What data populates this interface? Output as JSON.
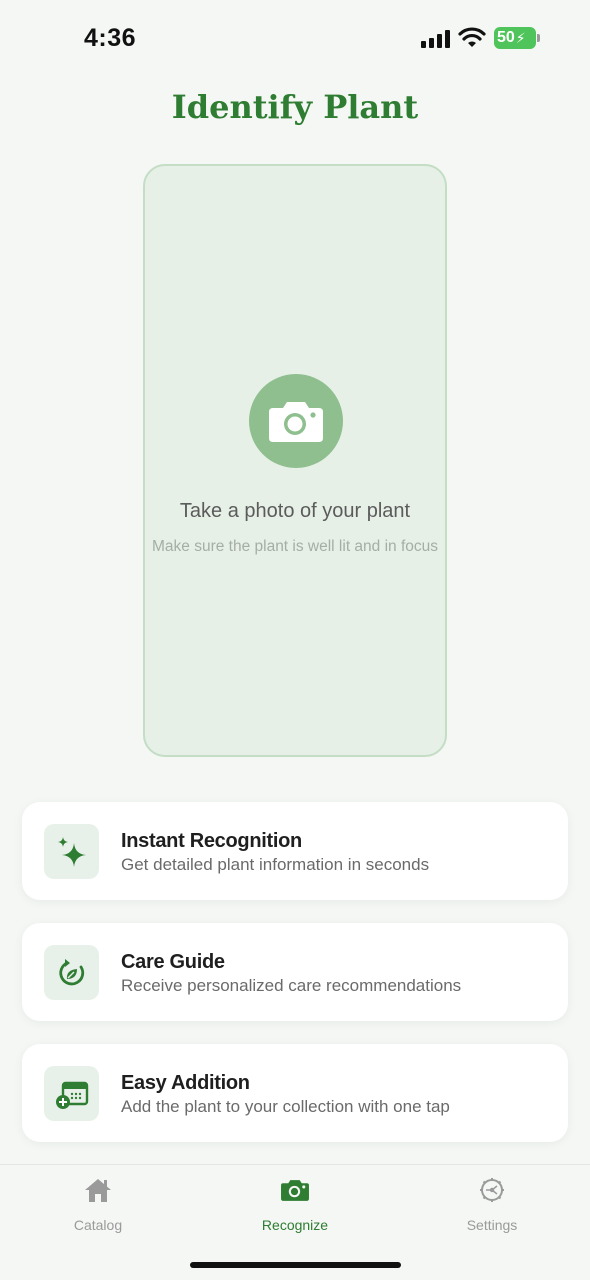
{
  "status_bar": {
    "time": "4:36",
    "battery": "50"
  },
  "header": {
    "title": "Identify Plant"
  },
  "camera": {
    "prompt": "Take a photo of your plant",
    "hint": "Make sure the plant is well lit and in focus"
  },
  "features": [
    {
      "title": "Instant Recognition",
      "description": "Get detailed plant information in seconds",
      "icon": "sparkles-icon"
    },
    {
      "title": "Care Guide",
      "description": "Receive personalized care recommendations",
      "icon": "care-cycle-icon"
    },
    {
      "title": "Easy Addition",
      "description": "Add the plant to your collection with one tap",
      "icon": "calendar-add-icon"
    }
  ],
  "tabs": [
    {
      "label": "Catalog",
      "icon": "home-icon",
      "active": false
    },
    {
      "label": "Recognize",
      "icon": "camera-icon",
      "active": true
    },
    {
      "label": "Settings",
      "icon": "gear-icon",
      "active": false
    }
  ],
  "colors": {
    "accent": "#2e7d32",
    "camera_area": "#e6f0e7",
    "camera_circle": "#8fbf8f",
    "inactive": "#9a9a9a"
  }
}
